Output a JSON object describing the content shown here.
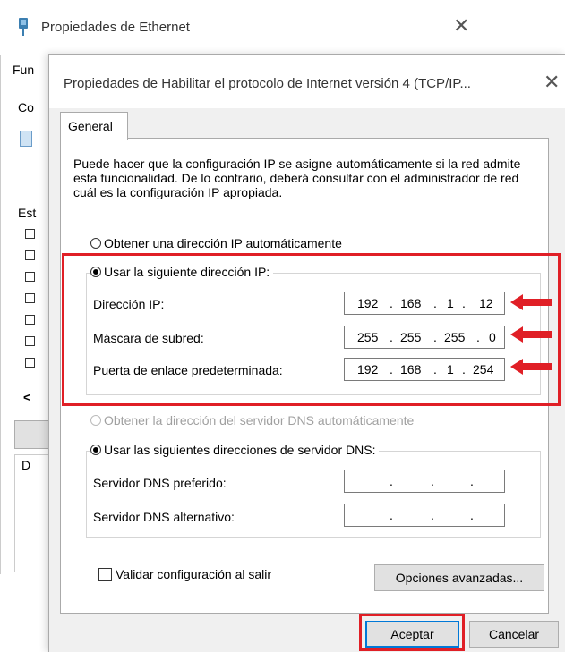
{
  "background_window": {
    "title": "Propiedades de Ethernet",
    "close_glyph": "✕",
    "frag_tab": "Fun",
    "frag_co": "Co",
    "frag_es": "Est",
    "frag_d": "D",
    "frag_arrow": "<"
  },
  "dialog": {
    "title": "Propiedades de Habilitar el protocolo de Internet versión 4 (TCP/IP...",
    "close_glyph": "✕",
    "tab_general": "General",
    "description": "Puede hacer que la configuración IP se asigne automáticamente si la red admite esta funcionalidad. De lo contrario, deberá consultar con el administrador de red cuál es la configuración IP apropiada.",
    "ip_auto_label": "Obtener una dirección IP automáticamente",
    "ip_manual_label": "Usar la siguiente dirección IP:",
    "ip_address_label": "Dirección IP:",
    "subnet_label": "Máscara de subred:",
    "gateway_label": "Puerta de enlace predeterminada:",
    "ip_address": [
      "192",
      "168",
      "1",
      "12"
    ],
    "subnet": [
      "255",
      "255",
      "255",
      "0"
    ],
    "gateway": [
      "192",
      "168",
      "1",
      "254"
    ],
    "dns_auto_label": "Obtener la dirección del servidor DNS automáticamente",
    "dns_manual_label": "Usar las siguientes direcciones de servidor DNS:",
    "dns_preferred_label": "Servidor DNS preferido:",
    "dns_alternate_label": "Servidor DNS alternativo:",
    "dot": ".",
    "validate_label": "Validar configuración al salir",
    "advanced_button": "Opciones avanzadas...",
    "ok_button": "Aceptar",
    "cancel_button": "Cancelar"
  },
  "colors": {
    "highlight_red": "#e01f26",
    "dialog_bg": "#f0f0f0",
    "button_bg": "#e1e1e1"
  }
}
